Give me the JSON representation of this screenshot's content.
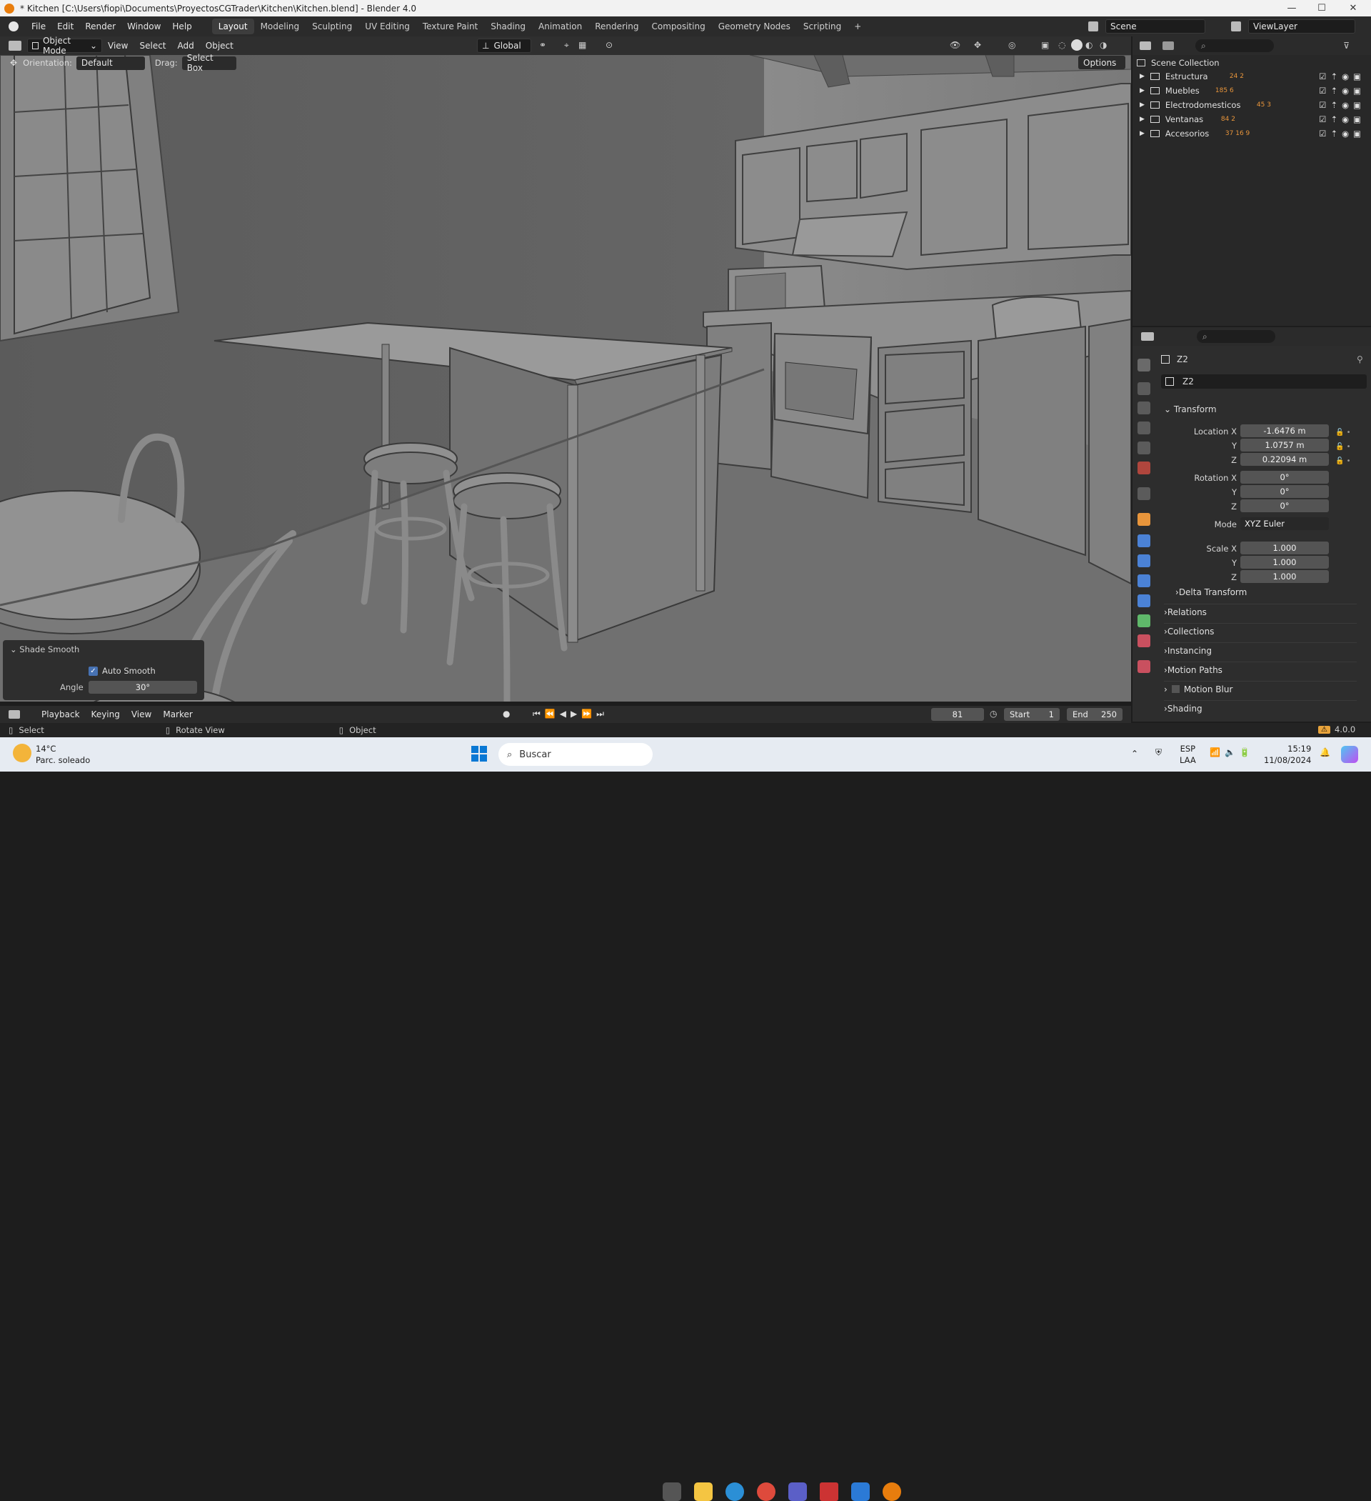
{
  "window": {
    "title": "* Kitchen [C:\\Users\\fiopi\\Documents\\ProyectosCGTrader\\Kitchen\\Kitchen.blend] - Blender 4.0",
    "minimize": "—",
    "maximize": "☐",
    "close": "✕"
  },
  "menu": [
    "File",
    "Edit",
    "Render",
    "Window",
    "Help"
  ],
  "workspaces": [
    "Layout",
    "Modeling",
    "Sculpting",
    "UV Editing",
    "Texture Paint",
    "Shading",
    "Animation",
    "Rendering",
    "Compositing",
    "Geometry Nodes",
    "Scripting",
    "+"
  ],
  "scene": "Scene",
  "view_layer": "ViewLayer",
  "viewport_header": {
    "mode": "Object Mode",
    "menus": [
      "View",
      "Select",
      "Add",
      "Object"
    ],
    "transform_orientation": "Global",
    "options": "Options"
  },
  "tool_header": {
    "orientation_label": "Orientation:",
    "orientation_value": "Default",
    "drag_label": "Drag:",
    "drag_value": "Select Box"
  },
  "outliner": {
    "root": "Scene Collection",
    "collections": [
      {
        "name": "Estructura",
        "counts": "24  2"
      },
      {
        "name": "Muebles",
        "counts": "185  6"
      },
      {
        "name": "Electrodomesticos",
        "counts": "45  3"
      },
      {
        "name": "Ventanas",
        "counts": "84  2"
      },
      {
        "name": "Accesorios",
        "counts": "37  16  9"
      }
    ]
  },
  "properties": {
    "object_name": "Z2",
    "data_name": "Z2",
    "transform_title": "Transform",
    "location_label": "Location X",
    "location": {
      "x": "-1.6476 m",
      "y": "1.0757 m",
      "z": "0.22094 m"
    },
    "rotation_label": "Rotation X",
    "rotation": {
      "x": "0°",
      "y": "0°",
      "z": "0°"
    },
    "mode_label": "Mode",
    "mode": "XYZ Euler",
    "scale_label": "Scale X",
    "scale": {
      "x": "1.000",
      "y": "1.000",
      "z": "1.000"
    },
    "axis_y": "Y",
    "axis_z": "Z",
    "sections": [
      "Delta Transform",
      "Relations",
      "Collections",
      "Instancing",
      "Motion Paths",
      "Motion Blur",
      "Shading"
    ]
  },
  "shade_smooth": {
    "title": "Shade Smooth",
    "auto_smooth_label": "Auto Smooth",
    "auto_smooth": true,
    "angle_label": "Angle",
    "angle": "30°"
  },
  "timeline": {
    "menus": [
      "Playback",
      "Keying",
      "View",
      "Marker"
    ],
    "current_frame": "81",
    "start_label": "Start",
    "start": "1",
    "end_label": "End",
    "end": "250"
  },
  "statusbar": {
    "select": "Select",
    "rotate": "Rotate View",
    "object": "Object",
    "version": "4.0.0"
  },
  "taskbar": {
    "temp": "14°C",
    "weather": "Parc. soleado",
    "search": "Buscar",
    "lang1": "ESP",
    "lang2": "LAA",
    "time": "15:19",
    "date": "11/08/2024"
  },
  "colors": {
    "accent": "#4772b3",
    "blender_orange": "#e87d0d",
    "viewport_bg": "#6c6c6c"
  }
}
